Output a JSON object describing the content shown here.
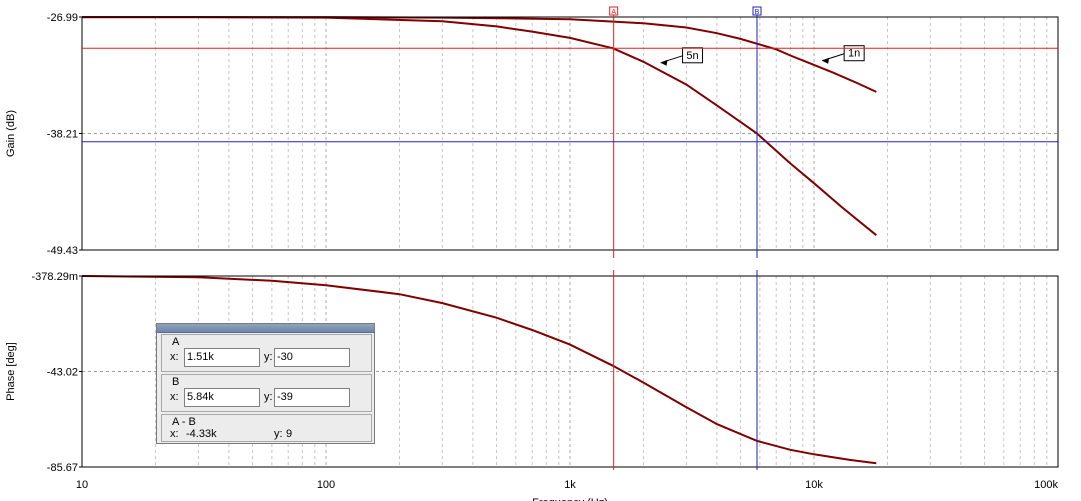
{
  "colors": {
    "curve": "#800000",
    "cursor_a": "#e02020",
    "cursor_b": "#2020c0",
    "grid": "#a0a0a0"
  },
  "chart_data": [
    {
      "type": "line",
      "xscale": "log",
      "xlim": [
        10,
        100000
      ],
      "ylim": [
        -49.43,
        -26.99
      ],
      "ylabel": "Gain (dB)",
      "y_ticks": [
        "-26.99",
        "-38.21",
        "-49.43"
      ],
      "grid": true,
      "series": [
        {
          "name": "1n",
          "x": [
            10,
            30,
            100,
            300,
            1000,
            2000,
            3000,
            4000,
            5000,
            6000,
            7000,
            8000,
            10000,
            12000,
            15000,
            18000
          ],
          "y": [
            -27.0,
            -27.0,
            -27.0,
            -27.05,
            -27.2,
            -27.6,
            -28.0,
            -28.55,
            -29.1,
            -29.65,
            -30.1,
            -30.7,
            -31.6,
            -32.35,
            -33.35,
            -34.2
          ]
        },
        {
          "name": "5n",
          "x": [
            10,
            30,
            100,
            300,
            500,
            700,
            1000,
            1500,
            2000,
            3000,
            4000,
            5840,
            8000,
            10000,
            13000,
            18000
          ],
          "y": [
            -27.0,
            -27.0,
            -27.05,
            -27.4,
            -27.9,
            -28.4,
            -29.0,
            -30.0,
            -31.3,
            -33.5,
            -35.5,
            -38.21,
            -41.1,
            -43.0,
            -45.3,
            -48.0
          ]
        }
      ],
      "annotations": [
        {
          "text": "5n",
          "x": 2350,
          "y": -31.4
        },
        {
          "text": "1n",
          "x": 10800,
          "y": -31.2
        }
      ],
      "cursors": [
        {
          "name": "A",
          "x": 1510,
          "y": -30
        },
        {
          "name": "B",
          "x": 5840,
          "y": -39
        }
      ]
    },
    {
      "type": "line",
      "xscale": "log",
      "xlim": [
        10,
        100000
      ],
      "ylim": [
        -85.67,
        -0.37829
      ],
      "xlabel": "Frequency (Hz)",
      "ylabel": "Phase [deg]",
      "x_ticks": [
        "10",
        "100",
        "1k",
        "10k",
        "100k"
      ],
      "y_ticks": [
        "-378.29m",
        "-43.02",
        "-85.67"
      ],
      "grid": true,
      "series": [
        {
          "name": "phase",
          "x": [
            10,
            30,
            60,
            100,
            200,
            300,
            500,
            700,
            1000,
            1500,
            2000,
            3000,
            4000,
            5840,
            8000,
            10000,
            14000,
            18000
          ],
          "y": [
            -0.4,
            -0.9,
            -2.5,
            -4.5,
            -8.5,
            -12.5,
            -19.0,
            -24.5,
            -31.0,
            -40.5,
            -48.0,
            -59.0,
            -66.5,
            -74.0,
            -78.0,
            -80.0,
            -82.5,
            -84.0
          ]
        }
      ],
      "cursors": [
        {
          "name": "A",
          "x": 1510
        },
        {
          "name": "B",
          "x": 5840
        }
      ]
    }
  ],
  "cursor_panel": {
    "a": {
      "label": "A",
      "x_label": "x:",
      "x_value": "1.51k",
      "y_label": "y:",
      "y_value": "-30"
    },
    "b": {
      "label": "B",
      "x_label": "x:",
      "x_value": "5.84k",
      "y_label": "y:",
      "y_value": "-39"
    },
    "diff": {
      "label": "A - B",
      "x_label": "x:",
      "x_value": "-4.33k",
      "y_label": "y:",
      "y_value": "9"
    }
  }
}
